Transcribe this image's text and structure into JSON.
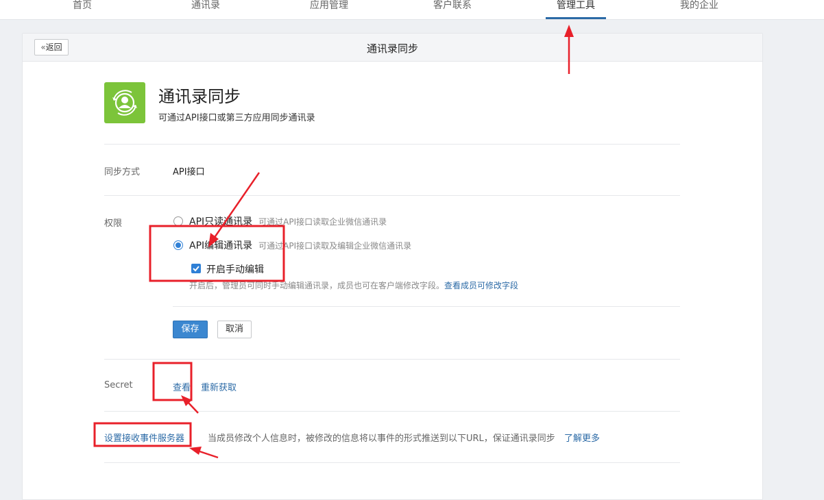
{
  "nav": {
    "items": [
      "首页",
      "通讯录",
      "应用管理",
      "客户联系",
      "管理工具",
      "我的企业"
    ],
    "active_index": 4
  },
  "header": {
    "back_label": "返回",
    "title": "通讯录同步"
  },
  "app": {
    "icon": "contact-sync-icon",
    "title": "通讯录同步",
    "description": "可通过API接口或第三方应用同步通讯录"
  },
  "sync": {
    "label": "同步方式",
    "value": "API接口"
  },
  "permission": {
    "label": "权限",
    "options": [
      {
        "label": "API只读通讯录",
        "hint": "可通过API接口读取企业微信通讯录",
        "checked": false
      },
      {
        "label": "API编辑通讯录",
        "hint": "可通过API接口读取及编辑企业微信通讯录",
        "checked": true
      }
    ],
    "manual_edit_label": "开启手动编辑",
    "manual_edit_checked": true,
    "note": "开启后，管理员可同时手动编辑通讯录，成员也可在客户端修改字段。",
    "note_link": "查看成员可修改字段"
  },
  "actions": {
    "save": "保存",
    "cancel": "取消"
  },
  "secret": {
    "label": "Secret",
    "view": "查看",
    "refresh": "重新获取"
  },
  "event": {
    "link": "设置接收事件服务器",
    "description": "当成员修改个人信息时，被修改的信息将以事件的形式推送到以下URL，保证通讯录同步",
    "learn_more": "了解更多"
  },
  "colors": {
    "accent": "#2b6aa6",
    "app_icon_bg": "#7cc43a",
    "annotation": "#e8202a"
  }
}
